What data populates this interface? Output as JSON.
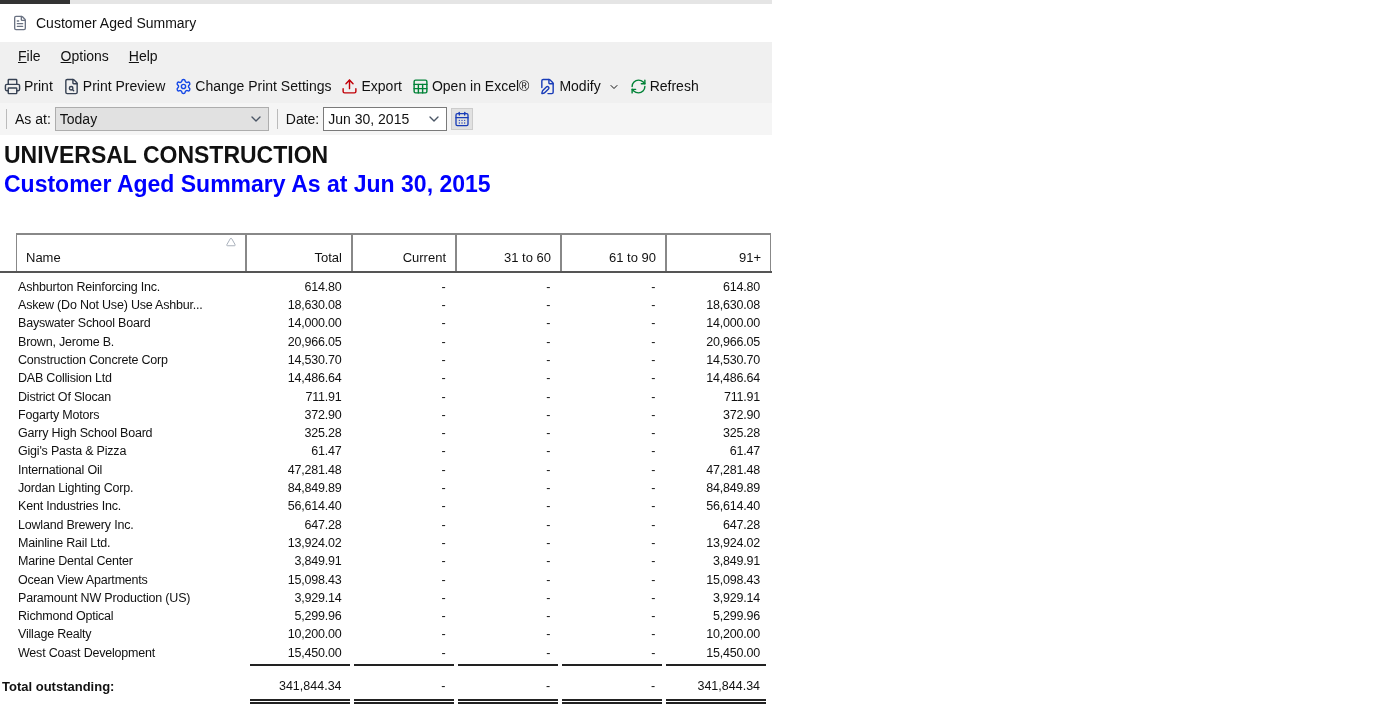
{
  "window": {
    "title": "Customer Aged Summary"
  },
  "menu": [
    "File",
    "Options",
    "Help"
  ],
  "toolbar": [
    {
      "kind": "print",
      "label": "Print"
    },
    {
      "kind": "preview",
      "label": "Print Preview"
    },
    {
      "kind": "settings",
      "label": "Change Print Settings"
    },
    {
      "kind": "export",
      "label": "Export"
    },
    {
      "kind": "excel",
      "label": "Open in Excel®"
    },
    {
      "kind": "modify",
      "label": "Modify"
    },
    {
      "kind": "refresh",
      "label": "Refresh"
    }
  ],
  "filters": {
    "as_at_label": "As at:",
    "as_at_value": "Today",
    "date_label": "Date:",
    "date_value": "Jun 30, 2015"
  },
  "report": {
    "company": "UNIVERSAL CONSTRUCTION",
    "title": "Customer Aged Summary As at Jun 30, 2015"
  },
  "table": {
    "columns": [
      "Name",
      "Total",
      "Current",
      "31 to 60",
      "61 to 90",
      "91+"
    ],
    "rows": [
      [
        "Ashburton Reinforcing Inc.",
        "614.80",
        "-",
        "-",
        "-",
        "614.80"
      ],
      [
        "Askew (Do Not Use) Use Ashbur...",
        "18,630.08",
        "-",
        "-",
        "-",
        "18,630.08"
      ],
      [
        "Bayswater School Board",
        "14,000.00",
        "-",
        "-",
        "-",
        "14,000.00"
      ],
      [
        "Brown, Jerome B.",
        "20,966.05",
        "-",
        "-",
        "-",
        "20,966.05"
      ],
      [
        "Construction Concrete Corp",
        "14,530.70",
        "-",
        "-",
        "-",
        "14,530.70"
      ],
      [
        "DAB Collision Ltd",
        "14,486.64",
        "-",
        "-",
        "-",
        "14,486.64"
      ],
      [
        "District Of Slocan",
        "711.91",
        "-",
        "-",
        "-",
        "711.91"
      ],
      [
        "Fogarty Motors",
        "372.90",
        "-",
        "-",
        "-",
        "372.90"
      ],
      [
        "Garry High School Board",
        "325.28",
        "-",
        "-",
        "-",
        "325.28"
      ],
      [
        "Gigi's Pasta & Pizza",
        "61.47",
        "-",
        "-",
        "-",
        "61.47"
      ],
      [
        "International Oil",
        "47,281.48",
        "-",
        "-",
        "-",
        "47,281.48"
      ],
      [
        "Jordan Lighting Corp.",
        "84,849.89",
        "-",
        "-",
        "-",
        "84,849.89"
      ],
      [
        "Kent Industries Inc.",
        "56,614.40",
        "-",
        "-",
        "-",
        "56,614.40"
      ],
      [
        "Lowland Brewery Inc.",
        "647.28",
        "-",
        "-",
        "-",
        "647.28"
      ],
      [
        "Mainline Rail Ltd.",
        "13,924.02",
        "-",
        "-",
        "-",
        "13,924.02"
      ],
      [
        "Marine Dental Center",
        "3,849.91",
        "-",
        "-",
        "-",
        "3,849.91"
      ],
      [
        "Ocean View Apartments",
        "15,098.43",
        "-",
        "-",
        "-",
        "15,098.43"
      ],
      [
        "Paramount NW Production (US)",
        "3,929.14",
        "-",
        "-",
        "-",
        "3,929.14"
      ],
      [
        "Richmond Optical",
        "5,299.96",
        "-",
        "-",
        "-",
        "5,299.96"
      ],
      [
        "Village Realty",
        "10,200.00",
        "-",
        "-",
        "-",
        "10,200.00"
      ],
      [
        "West Coast Development",
        "15,450.00",
        "-",
        "-",
        "-",
        "15,450.00"
      ]
    ],
    "total": [
      "Total outstanding:",
      "341,844.34",
      "-",
      "-",
      "-",
      "341,844.34"
    ]
  }
}
